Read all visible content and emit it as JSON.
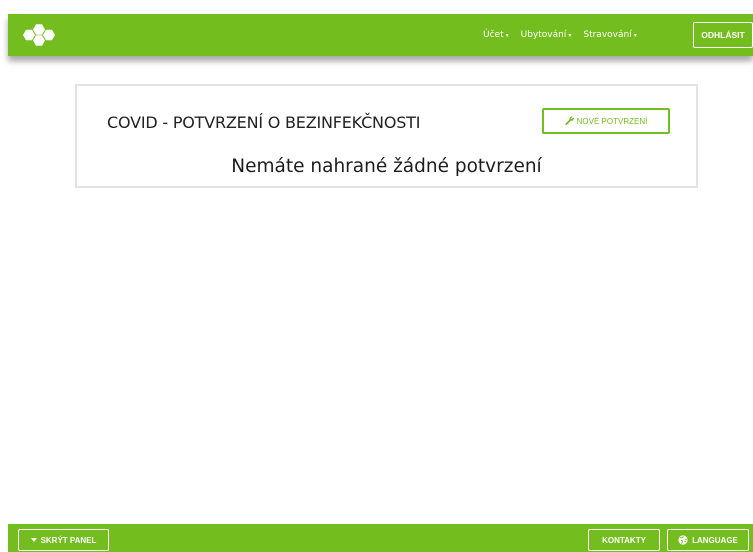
{
  "nav": {
    "items": [
      {
        "label": "Účet",
        "caret": "▾"
      },
      {
        "label": "Ubytování",
        "caret": "▾"
      },
      {
        "label": "Stravování",
        "caret": "▾"
      }
    ],
    "logout_label": "ODHLÁSIT"
  },
  "card": {
    "title": "COVID - POTVRZENÍ O BEZINFEKČNOSTI",
    "new_button_label": "NOVÉ POTVRZENÍ",
    "new_button_icon": "wrench-icon",
    "empty_message": "Nemáte nahrané žádné potvrzení"
  },
  "footer": {
    "hide_panel_label": "SKRÝT PANEL",
    "hide_panel_icon": "caret-down-icon",
    "contacts_label": "KONTAKTY",
    "language_label": "LANGUAGE",
    "language_icon": "globe-icon"
  },
  "colors": {
    "brand_green": "#74bd1e",
    "card_border": "#e3e3e3"
  }
}
